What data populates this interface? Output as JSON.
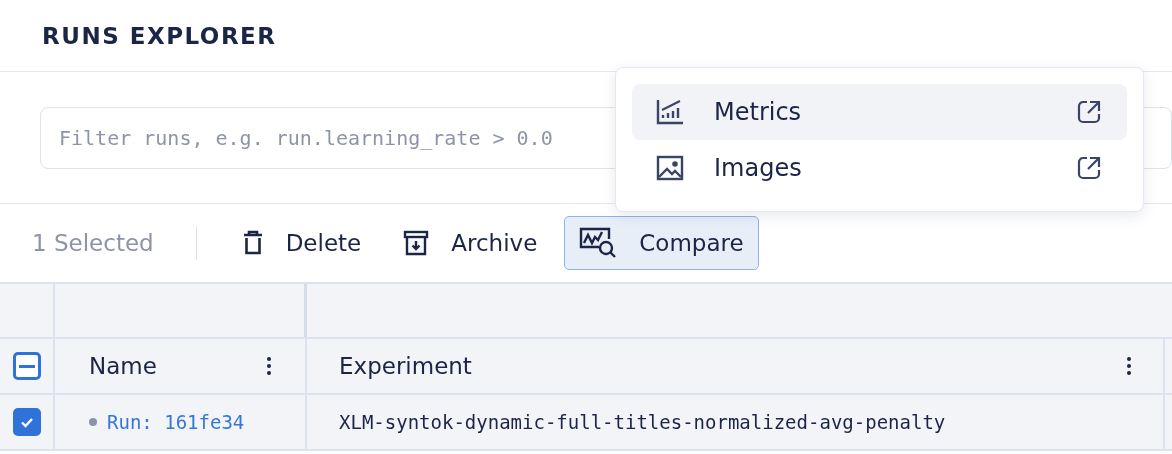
{
  "header": {
    "title": "RUNS EXPLORER"
  },
  "filter": {
    "placeholder": "Filter runs, e.g. run.learning_rate > 0.0"
  },
  "toolbar": {
    "selection_count": "1 Selected",
    "actions": [
      {
        "kind": "delete",
        "label": "Delete",
        "active": false
      },
      {
        "kind": "archive",
        "label": "Archive",
        "active": false
      },
      {
        "kind": "compare",
        "label": "Compare",
        "active": true
      }
    ]
  },
  "compare_menu": {
    "items": [
      {
        "kind": "metrics",
        "label": "Metrics",
        "selected": true
      },
      {
        "kind": "images",
        "label": "Images",
        "selected": false
      }
    ]
  },
  "table": {
    "header_checkbox": {
      "indeterminate": true
    },
    "columns": [
      {
        "label": "Name"
      },
      {
        "label": "Experiment"
      }
    ],
    "rows": [
      {
        "checked": true,
        "name": "Run: 161fe34",
        "experiment": "XLM-syntok-dynamic-full-titles-normalized-avg-penalty"
      }
    ]
  }
}
